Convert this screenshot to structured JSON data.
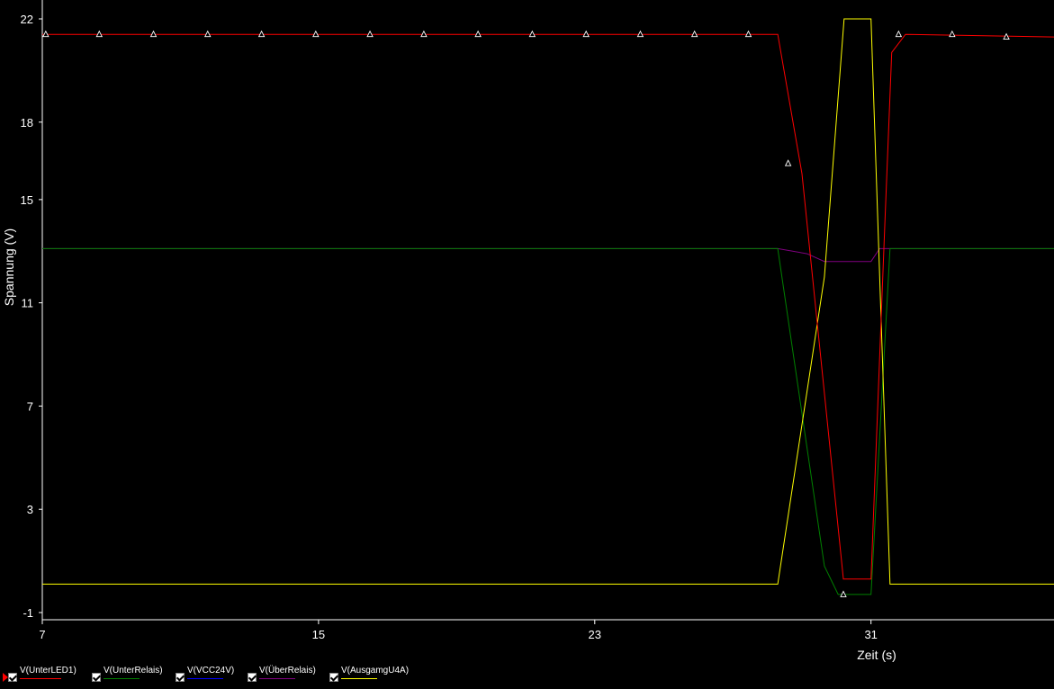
{
  "chart_data": {
    "type": "line",
    "xlabel": "Zeit (s)",
    "ylabel": "Spannung (V)",
    "xlim": [
      7,
      36.3
    ],
    "ylim": [
      -1,
      22
    ],
    "x_ticks": [
      7,
      15,
      23,
      31
    ],
    "y_ticks": [
      -1,
      3,
      7,
      11,
      15,
      18,
      22
    ],
    "grid": false,
    "legend_position": "bottom-left",
    "series": [
      {
        "name": "V(UnterLED1)",
        "color": "#ff0000",
        "marker": "triangle",
        "x": [
          7,
          28.3,
          29.0,
          30.2,
          31.0,
          31.4,
          31.6,
          32.0,
          36.3
        ],
        "y": [
          21.4,
          21.4,
          16.0,
          0.3,
          0.3,
          14.0,
          20.7,
          21.4,
          21.3
        ],
        "marker_points": [
          [
            7.1,
            21.4
          ],
          [
            8.65,
            21.4
          ],
          [
            10.22,
            21.4
          ],
          [
            11.79,
            21.4
          ],
          [
            13.35,
            21.4
          ],
          [
            14.92,
            21.4
          ],
          [
            16.49,
            21.4
          ],
          [
            18.05,
            21.4
          ],
          [
            19.62,
            21.4
          ],
          [
            21.19,
            21.4
          ],
          [
            22.75,
            21.4
          ],
          [
            24.32,
            21.4
          ],
          [
            25.89,
            21.4
          ],
          [
            27.45,
            21.4
          ],
          [
            28.6,
            16.4
          ],
          [
            30.2,
            -0.3
          ],
          [
            31.8,
            21.4
          ],
          [
            33.35,
            21.4
          ],
          [
            34.92,
            21.3
          ]
        ]
      },
      {
        "name": "V(UnterRelais)",
        "color": "#008000",
        "x": [
          7,
          28.3,
          29.65,
          30.05,
          31.0,
          31.55,
          36.3
        ],
        "y": [
          13.1,
          13.1,
          0.8,
          -0.3,
          -0.3,
          13.1,
          13.1
        ]
      },
      {
        "name": "V(VCC24V)",
        "color": "#0000ff",
        "x": [],
        "y": []
      },
      {
        "name": "V(ÜberRelais)",
        "color": "#800080",
        "x": [
          7,
          28.3,
          29.15,
          29.65,
          31.0,
          31.25,
          31.55,
          36.3
        ],
        "y": [
          13.1,
          13.1,
          12.9,
          12.6,
          12.6,
          13.1,
          13.1,
          13.1
        ],
        "bump": true
      },
      {
        "name": "V(AusgamgU4A)",
        "color": "#ffff00",
        "x": [
          7,
          28.3,
          29.65,
          30.22,
          31.0,
          31.55,
          36.3
        ],
        "y": [
          0.1,
          0.1,
          12.0,
          22.0,
          22.0,
          0.1,
          0.1
        ]
      }
    ]
  }
}
